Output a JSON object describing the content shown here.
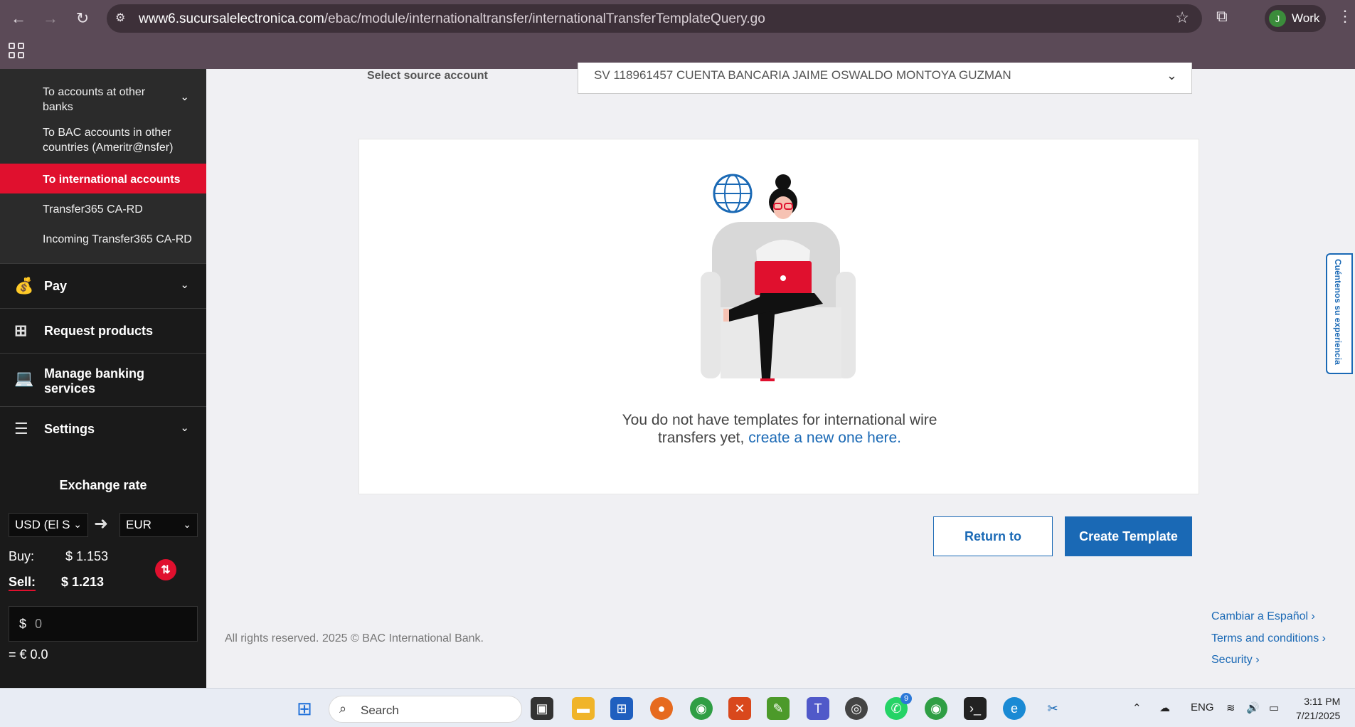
{
  "browser": {
    "url_host": "www6.sucursalelectronica.com",
    "url_path": "/ebac/module/internationaltransfer/internationalTransferTemplateQuery.go",
    "profile_label": "Work",
    "profile_initial": "J"
  },
  "sidebar": {
    "sub_items": [
      {
        "label": "To accounts at other banks"
      },
      {
        "label": "To BAC accounts in other countries (Ameritr@nsfer)"
      },
      {
        "label": "To international accounts"
      },
      {
        "label": "Transfer365 CA-RD"
      },
      {
        "label": "Incoming Transfer365 CA-RD"
      }
    ],
    "main_items": [
      {
        "label": "Pay",
        "icon": "money-bag-icon"
      },
      {
        "label": "Request products",
        "icon": "plus-icon"
      },
      {
        "label": "Manage banking services",
        "icon": "laptop-icon"
      },
      {
        "label": "Settings",
        "icon": "sliders-icon"
      }
    ],
    "exchange": {
      "title": "Exchange rate",
      "from_currency": "USD (El S",
      "to_currency": "EUR",
      "buy_label": "Buy:",
      "buy_value": "$ 1.153",
      "sell_label": "Sell:",
      "sell_value": "$ 1.213",
      "amount_symbol": "$",
      "amount_value": "0",
      "result": "= € 0.0"
    }
  },
  "main": {
    "source_label": "Select source account",
    "source_account": "SV 118961457 CUENTA BANCARIA JAIME OSWALDO MONTOYA GUZMAN",
    "empty_message_1": "You do not have templates for international wire",
    "empty_message_2": "transfers yet,",
    "empty_link": "create a new one here.",
    "return_button": "Return to",
    "create_button": "Create Template"
  },
  "footer": {
    "copyright": "All rights reserved. 2025 © BAC International Bank.",
    "links": [
      "Cambiar a Español",
      "Terms and conditions",
      "Security"
    ]
  },
  "feedback_tab": "Cuéntenos su experiencia",
  "taskbar": {
    "search_placeholder": "Search",
    "language": "ENG",
    "time": "3:11 PM",
    "date": "7/21/2025",
    "whatsapp_badge": "9"
  },
  "colors": {
    "brand_red": "#e0102e",
    "link_blue": "#1a69b5",
    "sidebar_bg": "#1a1a1a",
    "chrome_bg": "#5b4a57"
  }
}
